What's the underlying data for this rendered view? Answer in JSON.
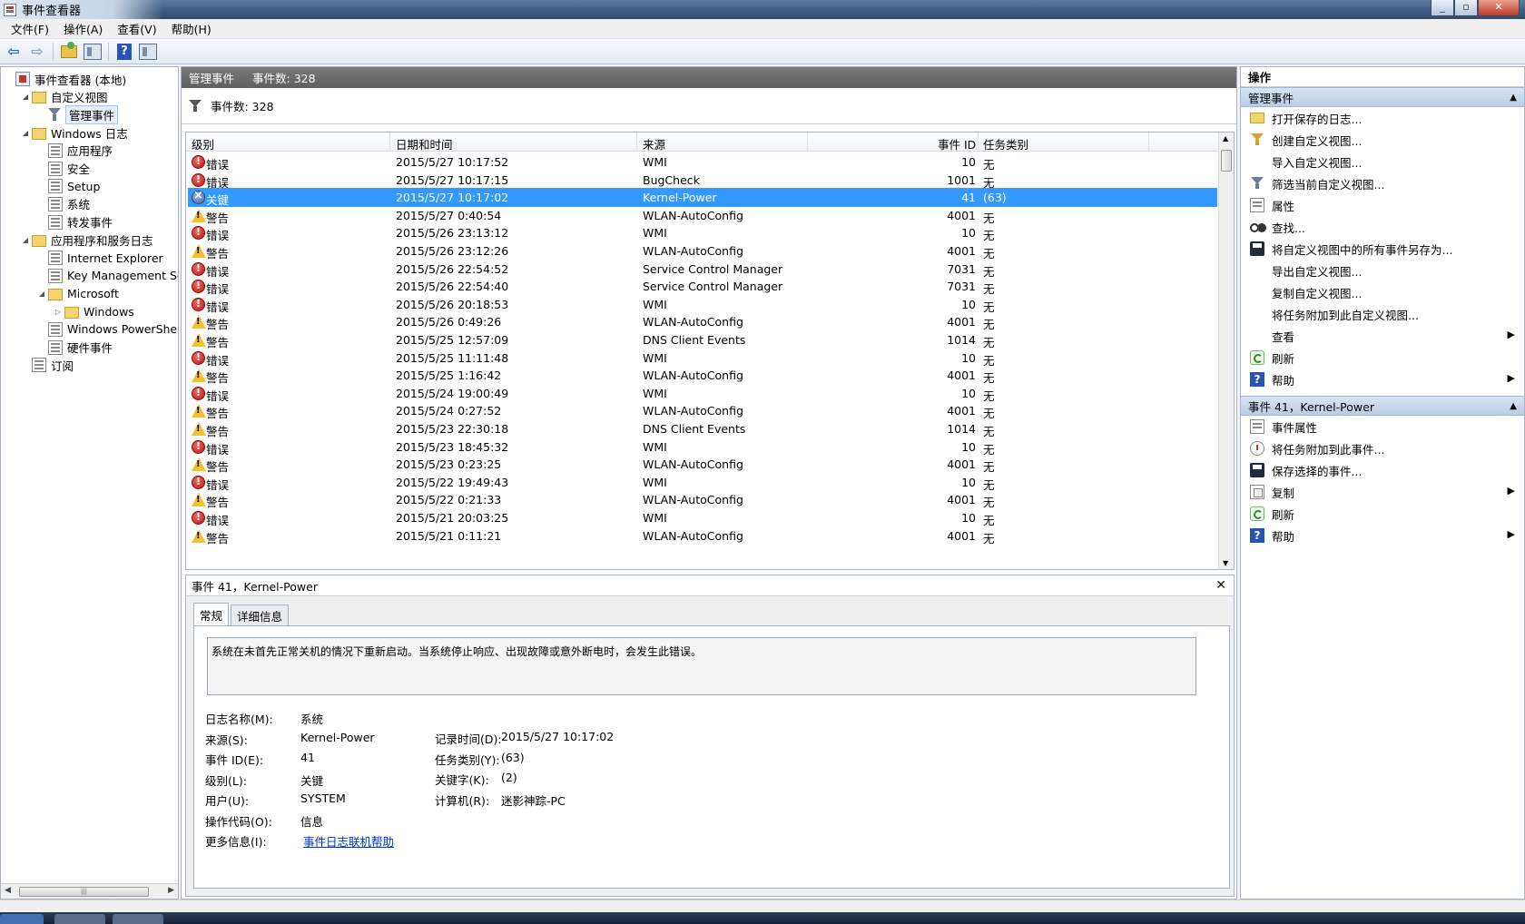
{
  "window": {
    "title": "事件查看器"
  },
  "menu": [
    {
      "label": "文件(F)"
    },
    {
      "label": "操作(A)"
    },
    {
      "label": "查看(V)"
    },
    {
      "label": "帮助(H)"
    }
  ],
  "tree": {
    "items": [
      {
        "label": "事件查看器 (本地)",
        "icon": "root-icon",
        "indent": 0,
        "expander": ""
      },
      {
        "label": "自定义视图",
        "icon": "folder-icon",
        "indent": 1,
        "expander": "◢"
      },
      {
        "label": "管理事件",
        "icon": "funnel-icon",
        "indent": 2,
        "expander": "",
        "selected": true
      },
      {
        "label": "Windows 日志",
        "icon": "folder-icon",
        "indent": 1,
        "expander": "◢"
      },
      {
        "label": "应用程序",
        "icon": "log-icon",
        "indent": 2,
        "expander": ""
      },
      {
        "label": "安全",
        "icon": "log-icon",
        "indent": 2,
        "expander": ""
      },
      {
        "label": "Setup",
        "icon": "log-icon",
        "indent": 2,
        "expander": ""
      },
      {
        "label": "系统",
        "icon": "log-icon",
        "indent": 2,
        "expander": ""
      },
      {
        "label": "转发事件",
        "icon": "log-icon",
        "indent": 2,
        "expander": ""
      },
      {
        "label": "应用程序和服务日志",
        "icon": "folder-icon",
        "indent": 1,
        "expander": "◢"
      },
      {
        "label": "Internet Explorer",
        "icon": "log-icon",
        "indent": 2,
        "expander": ""
      },
      {
        "label": "Key Management Serv",
        "icon": "log-icon",
        "indent": 2,
        "expander": ""
      },
      {
        "label": "Microsoft",
        "icon": "folder-icon",
        "indent": 2,
        "expander": "◢"
      },
      {
        "label": "Windows",
        "icon": "folder-icon",
        "indent": 3,
        "expander": "▷"
      },
      {
        "label": "Windows PowerShell",
        "icon": "log-icon",
        "indent": 2,
        "expander": ""
      },
      {
        "label": "硬件事件",
        "icon": "log-icon",
        "indent": 2,
        "expander": ""
      },
      {
        "label": "订阅",
        "icon": "log-icon",
        "indent": 1,
        "expander": ""
      }
    ]
  },
  "center": {
    "header_title": "管理事件",
    "header_count": "事件数: 328",
    "filter_text": "事件数: 328",
    "columns": [
      "级别",
      "日期和时间",
      "来源",
      "事件 ID",
      "任务类别"
    ],
    "rows": [
      {
        "level": "错误",
        "type": "error",
        "date": "2015/5/27 10:17:52",
        "source": "WMI",
        "id": "10",
        "task": "无"
      },
      {
        "level": "错误",
        "type": "error",
        "date": "2015/5/27 10:17:15",
        "source": "BugCheck",
        "id": "1001",
        "task": "无"
      },
      {
        "level": "关键",
        "type": "critical",
        "date": "2015/5/27 10:17:02",
        "source": "Kernel-Power",
        "id": "41",
        "task": "(63)",
        "selected": true
      },
      {
        "level": "警告",
        "type": "warning",
        "date": "2015/5/27 0:40:54",
        "source": "WLAN-AutoConfig",
        "id": "4001",
        "task": "无"
      },
      {
        "level": "错误",
        "type": "error",
        "date": "2015/5/26 23:13:12",
        "source": "WMI",
        "id": "10",
        "task": "无"
      },
      {
        "level": "警告",
        "type": "warning",
        "date": "2015/5/26 23:12:26",
        "source": "WLAN-AutoConfig",
        "id": "4001",
        "task": "无"
      },
      {
        "level": "错误",
        "type": "error",
        "date": "2015/5/26 22:54:52",
        "source": "Service Control Manager",
        "id": "7031",
        "task": "无"
      },
      {
        "level": "错误",
        "type": "error",
        "date": "2015/5/26 22:54:40",
        "source": "Service Control Manager",
        "id": "7031",
        "task": "无"
      },
      {
        "level": "错误",
        "type": "error",
        "date": "2015/5/26 20:18:53",
        "source": "WMI",
        "id": "10",
        "task": "无"
      },
      {
        "level": "警告",
        "type": "warning",
        "date": "2015/5/26 0:49:26",
        "source": "WLAN-AutoConfig",
        "id": "4001",
        "task": "无"
      },
      {
        "level": "警告",
        "type": "warning",
        "date": "2015/5/25 12:57:09",
        "source": "DNS Client Events",
        "id": "1014",
        "task": "无"
      },
      {
        "level": "错误",
        "type": "error",
        "date": "2015/5/25 11:11:48",
        "source": "WMI",
        "id": "10",
        "task": "无"
      },
      {
        "level": "警告",
        "type": "warning",
        "date": "2015/5/25 1:16:42",
        "source": "WLAN-AutoConfig",
        "id": "4001",
        "task": "无"
      },
      {
        "level": "错误",
        "type": "error",
        "date": "2015/5/24 19:00:49",
        "source": "WMI",
        "id": "10",
        "task": "无"
      },
      {
        "level": "警告",
        "type": "warning",
        "date": "2015/5/24 0:27:52",
        "source": "WLAN-AutoConfig",
        "id": "4001",
        "task": "无"
      },
      {
        "level": "警告",
        "type": "warning",
        "date": "2015/5/23 22:30:18",
        "source": "DNS Client Events",
        "id": "1014",
        "task": "无"
      },
      {
        "level": "错误",
        "type": "error",
        "date": "2015/5/23 18:45:32",
        "source": "WMI",
        "id": "10",
        "task": "无"
      },
      {
        "level": "警告",
        "type": "warning",
        "date": "2015/5/23 0:23:25",
        "source": "WLAN-AutoConfig",
        "id": "4001",
        "task": "无"
      },
      {
        "level": "错误",
        "type": "error",
        "date": "2015/5/22 19:49:43",
        "source": "WMI",
        "id": "10",
        "task": "无"
      },
      {
        "level": "警告",
        "type": "warning",
        "date": "2015/5/22 0:21:33",
        "source": "WLAN-AutoConfig",
        "id": "4001",
        "task": "无"
      },
      {
        "level": "错误",
        "type": "error",
        "date": "2015/5/21 20:03:25",
        "source": "WMI",
        "id": "10",
        "task": "无"
      },
      {
        "level": "警告",
        "type": "warning",
        "date": "2015/5/21 0:11:21",
        "source": "WLAN-AutoConfig",
        "id": "4001",
        "task": "无"
      }
    ]
  },
  "detail": {
    "title": "事件 41，Kernel-Power",
    "tabs": [
      "常规",
      "详细信息"
    ],
    "description": "系统在未首先正常关机的情况下重新启动。当系统停止响应、出现故障或意外断电时，会发生此错误。",
    "left_fields": [
      {
        "label": "日志名称(M):",
        "value": "系统"
      },
      {
        "label": "来源(S):",
        "value": "Kernel-Power"
      },
      {
        "label": "事件 ID(E):",
        "value": "41"
      },
      {
        "label": "级别(L):",
        "value": "关键"
      },
      {
        "label": "用户(U):",
        "value": "SYSTEM"
      },
      {
        "label": "操作代码(O):",
        "value": "信息"
      },
      {
        "label": "更多信息(I):",
        "value": "事件日志联机帮助"
      }
    ],
    "right_fields": [
      {
        "label": "记录时间(D):",
        "value": "2015/5/27 10:17:02"
      },
      {
        "label": "任务类别(Y):",
        "value": "(63)"
      },
      {
        "label": "关键字(K):",
        "value": "(2)"
      },
      {
        "label": "计算机(R):",
        "value": "迷影神踪-PC"
      }
    ]
  },
  "actions": {
    "title": "操作",
    "sections": [
      {
        "header": "管理事件",
        "items": [
          {
            "label": "打开保存的日志...",
            "icon": "i-open",
            "arrow": false
          },
          {
            "label": "创建自定义视图...",
            "icon": "i-funnel",
            "arrow": false
          },
          {
            "label": "导入自定义视图...",
            "icon": "",
            "arrow": false
          },
          {
            "label": "筛选当前自定义视图...",
            "icon": "i-filter",
            "arrow": false
          },
          {
            "label": "属性",
            "icon": "i-prop",
            "arrow": false
          },
          {
            "label": "查找...",
            "icon": "i-find",
            "arrow": false
          },
          {
            "label": "将自定义视图中的所有事件另存为...",
            "icon": "i-save",
            "arrow": false
          },
          {
            "label": "导出自定义视图...",
            "icon": "",
            "arrow": false
          },
          {
            "label": "复制自定义视图...",
            "icon": "",
            "arrow": false
          },
          {
            "label": "将任务附加到此自定义视图...",
            "icon": "",
            "arrow": false
          },
          {
            "label": "查看",
            "icon": "",
            "arrow": true
          },
          {
            "label": "刷新",
            "icon": "i-refresh",
            "arrow": false
          },
          {
            "label": "帮助",
            "icon": "i-help",
            "arrow": true
          }
        ]
      },
      {
        "header": "事件 41，Kernel-Power",
        "items": [
          {
            "label": "事件属性",
            "icon": "i-prop",
            "arrow": false
          },
          {
            "label": "将任务附加到此事件...",
            "icon": "i-attach",
            "arrow": false
          },
          {
            "label": "保存选择的事件...",
            "icon": "i-save",
            "arrow": false
          },
          {
            "label": "复制",
            "icon": "i-copy",
            "arrow": true
          },
          {
            "label": "刷新",
            "icon": "i-refresh",
            "arrow": false
          },
          {
            "label": "帮助",
            "icon": "i-help",
            "arrow": true
          }
        ]
      }
    ]
  }
}
